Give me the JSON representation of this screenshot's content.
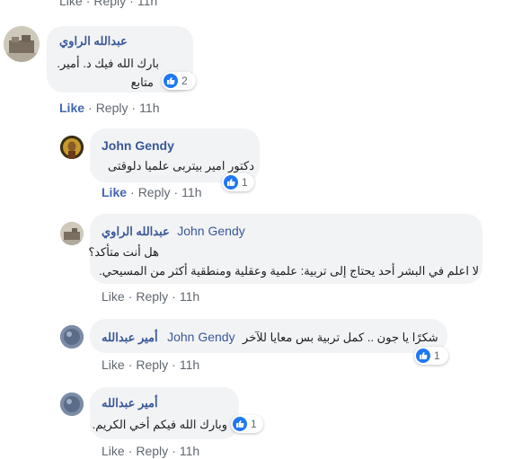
{
  "top_actions": {
    "like": "Like",
    "reply": "Reply",
    "time": "11h"
  },
  "comments": [
    {
      "author": "عبدالله الراوي",
      "lines": [
        "بارك الله فيك د. أمير.",
        "متابع"
      ],
      "reactions": "2",
      "like": "Like",
      "reply": "Reply",
      "time": "11h"
    },
    {
      "author": "John Gendy",
      "lines": [
        "دكتور امير بيتربى علميا دلوقتى"
      ],
      "reactions": "1",
      "like": "Like",
      "reply": "Reply",
      "time": "11h"
    },
    {
      "author": "عبدالله الراوي",
      "mention": "John Gendy",
      "lines": [
        "هل أنت متأكد؟",
        ".لا اعلم في البشر أحد يحتاج إلى تربية: علمية وعقلية ومنطقية أكثر من المسيحي"
      ],
      "like": "Like",
      "reply": "Reply",
      "time": "11h"
    },
    {
      "author": "أمير عبدالله",
      "mention": "John Gendy",
      "lines": [
        "شكرًا يا جون .. كمل تربية بس معايا للآخر"
      ],
      "reactions": "1",
      "like": "Like",
      "reply": "Reply",
      "time": "11h"
    },
    {
      "author": "أمير عبدالله",
      "lines": [
        "وبارك الله فيكم أخي الكريم."
      ],
      "reactions": "1",
      "like": "Like",
      "reply": "Reply",
      "time": "11h"
    }
  ],
  "colors": {
    "link": "#385898",
    "active_like": "#4267b2",
    "bubble": "#f2f3f5",
    "reaction": "#2078f4"
  }
}
